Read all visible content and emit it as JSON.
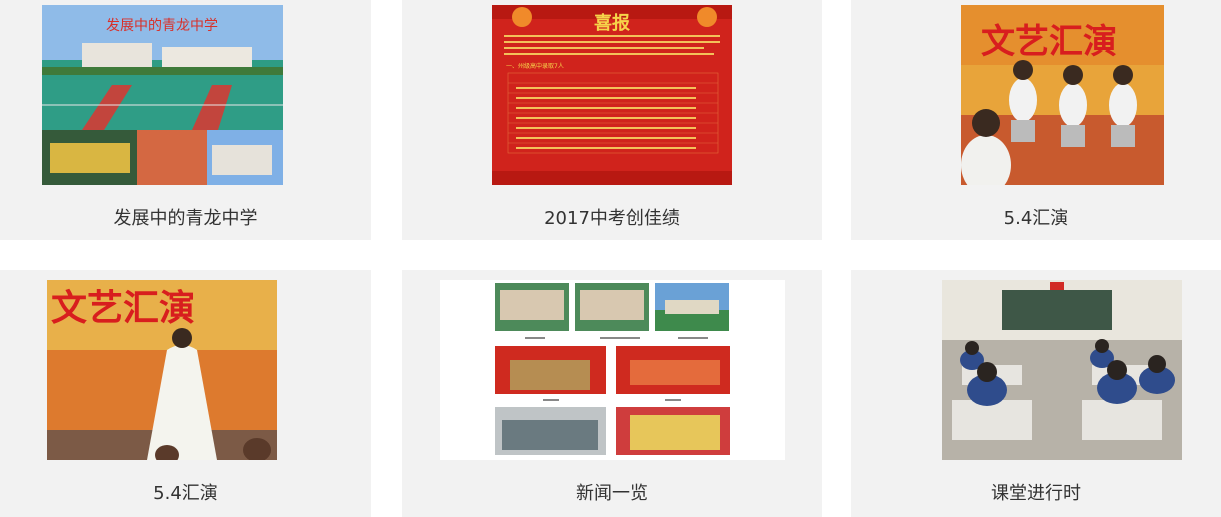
{
  "cards": [
    {
      "caption": "发展中的青龙中学",
      "thumb_title": "发展中的青龙中学",
      "colors": {
        "sky": "#7fb0e6",
        "court": "#2e9c84",
        "track": "#c2453d"
      }
    },
    {
      "caption": "2017中考创佳绩",
      "thumb_title": "喜报",
      "thumb_subtitle": "一、州级高中录取7人",
      "colors": {
        "bg": "#d0231c",
        "gold": "#f6d44a"
      }
    },
    {
      "caption": "5.4汇演",
      "thumb_title": "文艺汇演",
      "colors": {
        "bg": "#e8a43a",
        "stage": "#c85a2e"
      }
    },
    {
      "caption": "5.4汇演",
      "thumb_title": "文艺汇演",
      "colors": {
        "bg": "#e8b04a",
        "dress": "#f4f4ee"
      }
    },
    {
      "caption": "新闻一览",
      "colors": {
        "red": "#cf2a1f",
        "green": "#3e8a4c"
      }
    },
    {
      "caption": "课堂进行时",
      "colors": {
        "wall": "#e9e6dd",
        "board": "#3e5747",
        "uniform": "#2f4c8c"
      }
    }
  ]
}
